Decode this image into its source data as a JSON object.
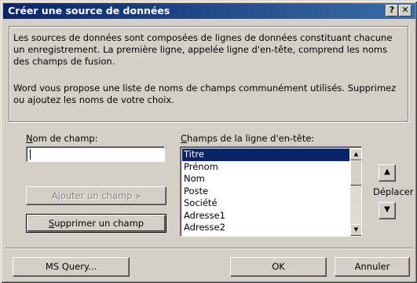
{
  "dialog": {
    "title": "Créer une source de données",
    "help_button": "?",
    "close_button": "✕"
  },
  "description": {
    "paragraph1": "Les sources de données sont composées de lignes de données constituant chacune un enregistrement. La première ligne, appelée ligne d'en-tête, comprend les noms des champs de fusion.",
    "paragraph2": "Word vous propose une liste de noms de champs communément utilisés. Supprimez ou ajoutez les noms de votre choix."
  },
  "field_name": {
    "label_accel": "N",
    "label_rest": "om de champ:",
    "value": ""
  },
  "header_fields": {
    "label_accel": "C",
    "label_rest": "hamps de la ligne d'en-tête:",
    "items": [
      "Titre",
      "Prénom",
      "Nom",
      "Poste",
      "Société",
      "Adresse1",
      "Adresse2"
    ],
    "selected": "Titre"
  },
  "buttons": {
    "add_field": "Ajouter un champ  »",
    "delete_field_accel": "S",
    "delete_field_rest": "upprimer un champ",
    "ms_query": "MS Query...",
    "ok": "OK",
    "cancel": "Annuler",
    "move_label": "Déplacer",
    "move_up": "▲",
    "move_down": "▼"
  },
  "colors": {
    "title_bar": "#0a246a",
    "selection": "#0a246a",
    "face": "#d4d0c8"
  }
}
